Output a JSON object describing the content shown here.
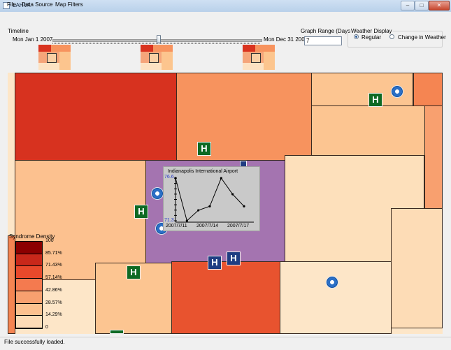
{
  "window": {
    "title": "LAHVA",
    "minimize": "–",
    "maximize": "□",
    "close": "✕"
  },
  "menu": [
    {
      "label": "File"
    },
    {
      "label": "Data Source"
    },
    {
      "label": "Map Filters"
    }
  ],
  "timeline": {
    "label": "Timeline",
    "start": "Mon Jan 1 2007",
    "end": "Mon Dec 31 2007",
    "position": 0.51
  },
  "graph_range": {
    "label": "Graph Range (Days)",
    "value": "7"
  },
  "weather_display": {
    "label": "Weather Display",
    "options": [
      {
        "label": "Regular",
        "selected": true
      },
      {
        "label": "Change in Weather",
        "selected": false
      }
    ]
  },
  "legend": {
    "title": "Syndrome Density",
    "levels": [
      {
        "label": "100",
        "color": "#8b0000"
      },
      {
        "label": "85.71%",
        "color": "#c8281a"
      },
      {
        "label": "71.43%",
        "color": "#e8492b"
      },
      {
        "label": "57.14%",
        "color": "#f47a4f"
      },
      {
        "label": "42.86%",
        "color": "#f8a06f"
      },
      {
        "label": "28.57%",
        "color": "#fcc18f"
      },
      {
        "label": "14.29%",
        "color": "#fddcb6"
      },
      {
        "label": "0",
        "color": "#fff3e2"
      }
    ]
  },
  "map": {
    "highlight_color": "#a474b0",
    "hospital_label": "H"
  },
  "graph": {
    "title": "Indianapolis International Airport",
    "y_max": "76.6",
    "y_min": "71.3",
    "x_labels": [
      "2007/7/11",
      "2007/7/14",
      "2007/7/17"
    ],
    "chart_data": {
      "type": "line",
      "x": [
        "2007/7/11",
        "2007/7/12",
        "2007/7/13",
        "2007/7/14",
        "2007/7/15",
        "2007/7/16",
        "2007/7/17"
      ],
      "values": [
        76.6,
        71.3,
        72.6,
        73.1,
        76.6,
        74.6,
        73.1
      ],
      "ylim": [
        71.3,
        76.6
      ]
    }
  },
  "status": {
    "text": "File successfully loaded."
  }
}
